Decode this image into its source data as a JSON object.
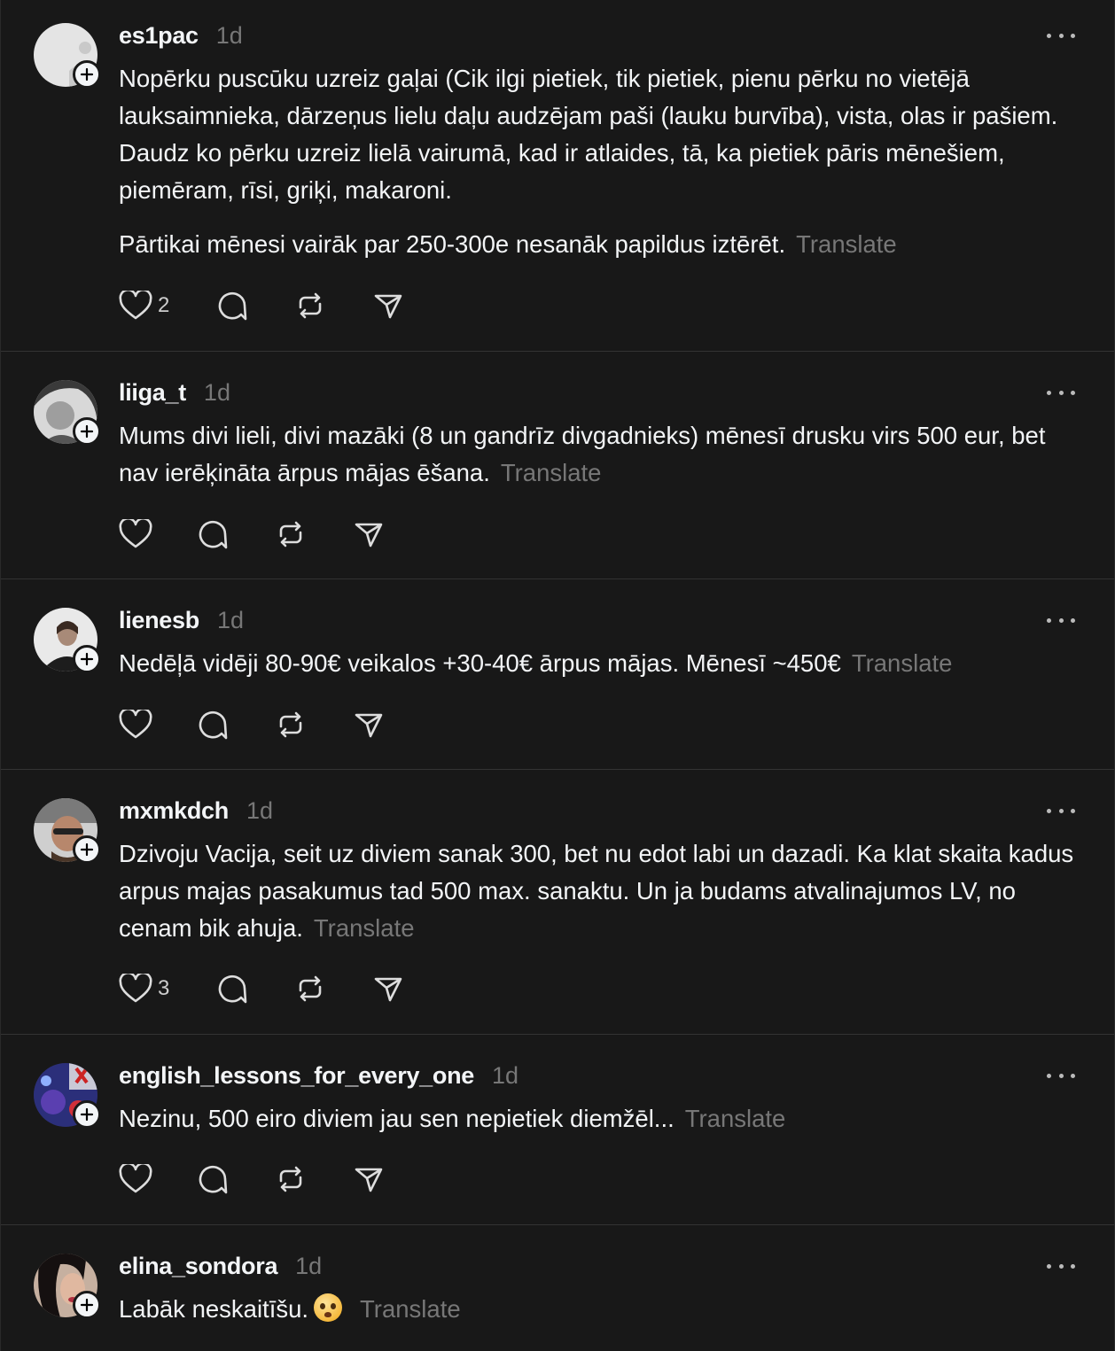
{
  "translate_label": "Translate",
  "posts": [
    {
      "username": "es1pac",
      "time": "1d",
      "paragraphs": [
        "Nopērku puscūku uzreiz gaļai (Cik ilgi pietiek, tik pietiek, pienu pērku no vietējā lauksaimnieka, dārzeņus lielu daļu audzējam paši (lauku burvība), vista, olas ir pašiem. Daudz ko pērku uzreiz lielā vairumā, kad ir atlaides, tā, ka pietiek pāris mēnešiem, piemēram, rīsi, griķi, makaroni.",
        "Pārtikai mēnesi vairāk par 250-300e nesanāk papildus iztērēt."
      ],
      "likes": "2",
      "avatar": "default-avatar-icon"
    },
    {
      "username": "liiga_t",
      "time": "1d",
      "paragraphs": [
        "Mums divi lieli, divi mazāki (8 un gandrīz divgadnieks) mēnesī drusku virs 500 eur, bet nav ierēķināta ārpus mājas ēšana."
      ],
      "likes": "",
      "avatar": "photo-avatar"
    },
    {
      "username": "lienesb",
      "time": "1d",
      "paragraphs": [
        "Nedēļā vidēji 80-90€ veikalos +30-40€ ārpus mājas. Mēnesī ~450€"
      ],
      "likes": "",
      "avatar": "photo-avatar"
    },
    {
      "username": "mxmkdch",
      "time": "1d",
      "paragraphs": [
        "Dzivoju Vacija, seit uz diviem sanak 300, bet nu edot labi un dazadi. Ka klat skaita kadus arpus majas pasakumus tad 500 max. sanaktu. Un ja budams atvalinajumos LV, no cenam bik ahuja."
      ],
      "likes": "3",
      "avatar": "photo-avatar"
    },
    {
      "username": "english_lessons_for_every_one",
      "time": "1d",
      "paragraphs": [
        "Nezinu, 500 eiro diviem jau sen nepietiek diemžēl..."
      ],
      "likes": "",
      "avatar": "photo-avatar"
    },
    {
      "username": "elina_sondora",
      "time": "1d",
      "paragraphs": [
        "Labāk neskaitīšu."
      ],
      "likes": "",
      "avatar": "photo-avatar",
      "emoji": "pleading-face-emoji"
    }
  ]
}
